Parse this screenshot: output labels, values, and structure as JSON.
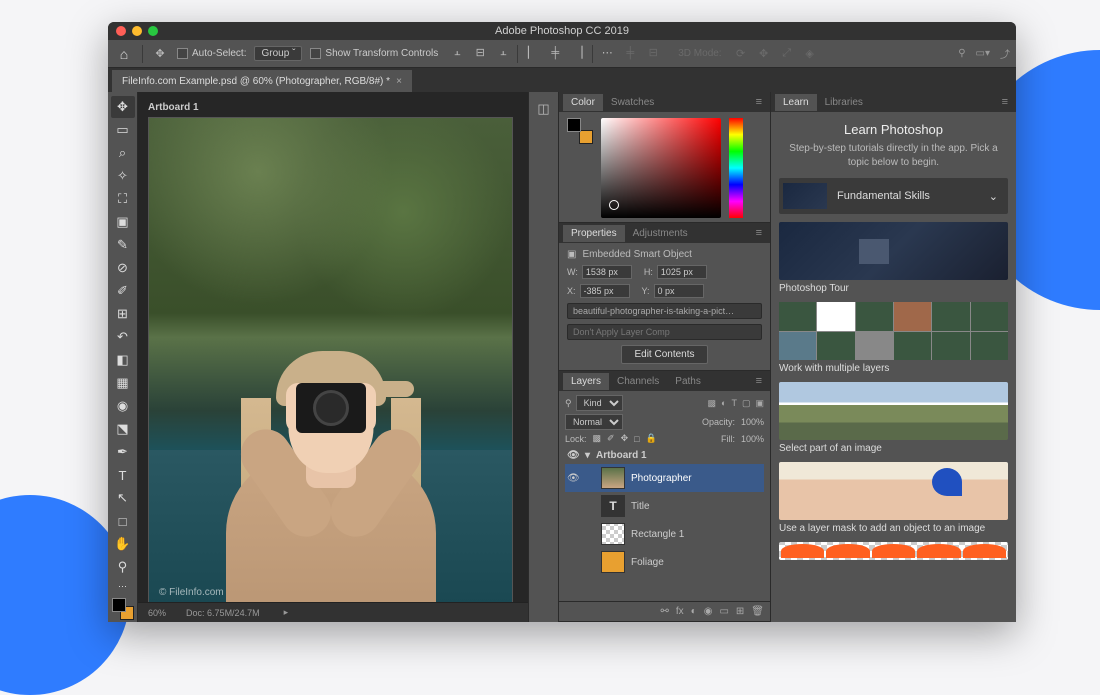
{
  "window": {
    "title": "Adobe Photoshop CC 2019"
  },
  "optionbar": {
    "auto_select_label": "Auto-Select:",
    "auto_select_mode": "Group",
    "transform_controls_label": "Show Transform Controls",
    "mode_3d_label": "3D Mode:"
  },
  "document": {
    "tab_label": "FileInfo.com Example.psd @ 60% (Photographer, RGB/8#) *",
    "artboard_label": "Artboard 1",
    "watermark": "© FileInfo.com"
  },
  "statusbar": {
    "zoom": "60%",
    "doc_size_label": "Doc:",
    "doc_size": "6.75M/24.7M"
  },
  "panels": {
    "color": {
      "tabs": [
        "Color",
        "Swatches"
      ]
    },
    "properties": {
      "tabs": [
        "Properties",
        "Adjustments"
      ],
      "object_type": "Embedded Smart Object",
      "w_label": "W:",
      "w_value": "1538 px",
      "h_label": "H:",
      "h_value": "1025 px",
      "x_label": "X:",
      "x_value": "-385 px",
      "y_label": "Y:",
      "y_value": "0 px",
      "filename": "beautiful-photographer-is-taking-a-pict…",
      "layer_comp": "Don't Apply Layer Comp",
      "edit_btn": "Edit Contents"
    },
    "layers": {
      "tabs": [
        "Layers",
        "Channels",
        "Paths"
      ],
      "filter_label": "Kind",
      "blend_mode": "Normal",
      "opacity_label": "Opacity:",
      "opacity_value": "100%",
      "lock_label": "Lock:",
      "fill_label": "Fill:",
      "fill_value": "100%",
      "items": [
        {
          "name": "Artboard 1",
          "type": "artboard"
        },
        {
          "name": "Photographer",
          "type": "smart",
          "selected": true
        },
        {
          "name": "Title",
          "type": "type"
        },
        {
          "name": "Rectangle 1",
          "type": "shape"
        },
        {
          "name": "Foliage",
          "type": "smart"
        }
      ]
    }
  },
  "learn": {
    "tabs": [
      "Learn",
      "Libraries"
    ],
    "title": "Learn Photoshop",
    "subtitle": "Step-by-step tutorials directly in the app. Pick a topic below to begin.",
    "section": "Fundamental Skills",
    "lessons": [
      "Photoshop Tour",
      "Work with multiple layers",
      "Select part of an image",
      "Use a layer mask to add an object to an image"
    ]
  }
}
